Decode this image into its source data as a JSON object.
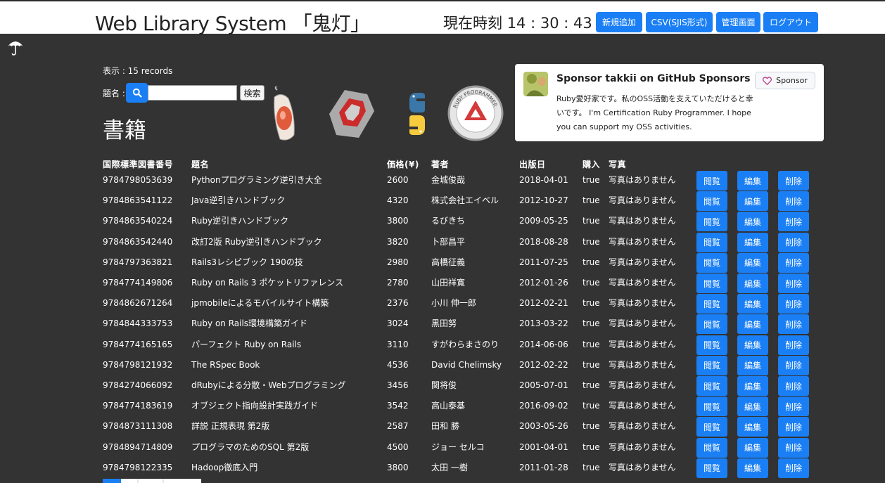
{
  "header": {
    "title": "Web Library System 「鬼灯」",
    "clock_label": "現在時刻",
    "clock_time": "14 : 30 : 43",
    "buttons": [
      {
        "label": "新規追加"
      },
      {
        "label": "CSV(SJIS形式)"
      },
      {
        "label": "管理画面"
      },
      {
        "label": "ログアウト"
      }
    ]
  },
  "sidebar": {
    "icon": "umbrella-icon"
  },
  "search": {
    "record_count": "表示 : 15 records",
    "label": "題名 :",
    "placeholder": "",
    "value": "",
    "submit_label": "検索"
  },
  "section_heading": "書籍",
  "logos": [
    "ruby-gem-logo",
    "rails-logo",
    "python-logo",
    "ruby-programmer-certified-badge"
  ],
  "sponsor": {
    "title": "Sponsor takkii on GitHub Sponsors",
    "text": "Ruby愛好家です。私のOSS活動を支えていただけると幸いです。 I'm Certification Ruby Programmer. I hope you can support my OSS activities.",
    "button_label": "Sponsor"
  },
  "table": {
    "headers": [
      "国際標準図書番号",
      "題名",
      "価格(¥)",
      "著者",
      "出版日",
      "購入",
      "写真"
    ],
    "action_labels": {
      "view": "閲覧",
      "edit": "編集",
      "delete": "削除"
    },
    "rows": [
      [
        "9784798053639",
        "Pythonプログラミング逆引き大全",
        "2600",
        "金城俊哉",
        "2018-04-01",
        "true",
        "写真はありません"
      ],
      [
        "9784863541122",
        "Java逆引きハンドブック",
        "4320",
        "株式会社エイベル",
        "2012-10-27",
        "true",
        "写真はありません"
      ],
      [
        "9784863540224",
        "Ruby逆引きハンドブック",
        "3800",
        "るびきち",
        "2009-05-25",
        "true",
        "写真はありません"
      ],
      [
        "9784863542440",
        "改訂2版 Ruby逆引きハンドブック",
        "3820",
        "卜部昌平",
        "2018-08-28",
        "true",
        "写真はありません"
      ],
      [
        "9784797363821",
        "Rails3レシピブック 190の技",
        "2980",
        "高橋征義",
        "2011-07-25",
        "true",
        "写真はありません"
      ],
      [
        "9784774149806",
        "Ruby on Rails 3 ポケットリファレンス",
        "2780",
        "山田祥寛",
        "2012-01-26",
        "true",
        "写真はありません"
      ],
      [
        "9784862671264",
        "jpmobileによるモバイルサイト構築",
        "2376",
        "小川 伸一郎",
        "2012-02-21",
        "true",
        "写真はありません"
      ],
      [
        "9784844333753",
        "Ruby on Rails環境構築ガイド",
        "3024",
        "黒田努",
        "2013-03-22",
        "true",
        "写真はありません"
      ],
      [
        "9784774165165",
        "パーフェクト Ruby on Rails",
        "3110",
        "すがわらまさのり",
        "2014-06-06",
        "true",
        "写真はありません"
      ],
      [
        "9784798121932",
        "The RSpec Book",
        "4536",
        "David Chelimsky",
        "2012-02-22",
        "true",
        "写真はありません"
      ],
      [
        "9784274066092",
        "dRubyによる分散・Webプログラミング",
        "3456",
        "関将俊",
        "2005-07-01",
        "true",
        "写真はありません"
      ],
      [
        "9784774183619",
        "オブジェクト指向設計実践ガイド",
        "3542",
        "高山泰基",
        "2016-09-02",
        "true",
        "写真はありません"
      ],
      [
        "9784873111308",
        "詳説 正規表現 第2版",
        "2587",
        "田和 勝",
        "2003-05-26",
        "true",
        "写真はありません"
      ],
      [
        "9784894714809",
        "プログラマのためのSQL 第2版",
        "4500",
        "ジョー セルコ",
        "2001-04-01",
        "true",
        "写真はありません"
      ],
      [
        "9784798122335",
        "Hadoop徹底入門",
        "3800",
        "太田 一樹",
        "2011-01-28",
        "true",
        "写真はありません"
      ]
    ]
  },
  "colors": {
    "accent": "#1a7ff5",
    "background": "#333333",
    "topbar": "#ffffff"
  }
}
